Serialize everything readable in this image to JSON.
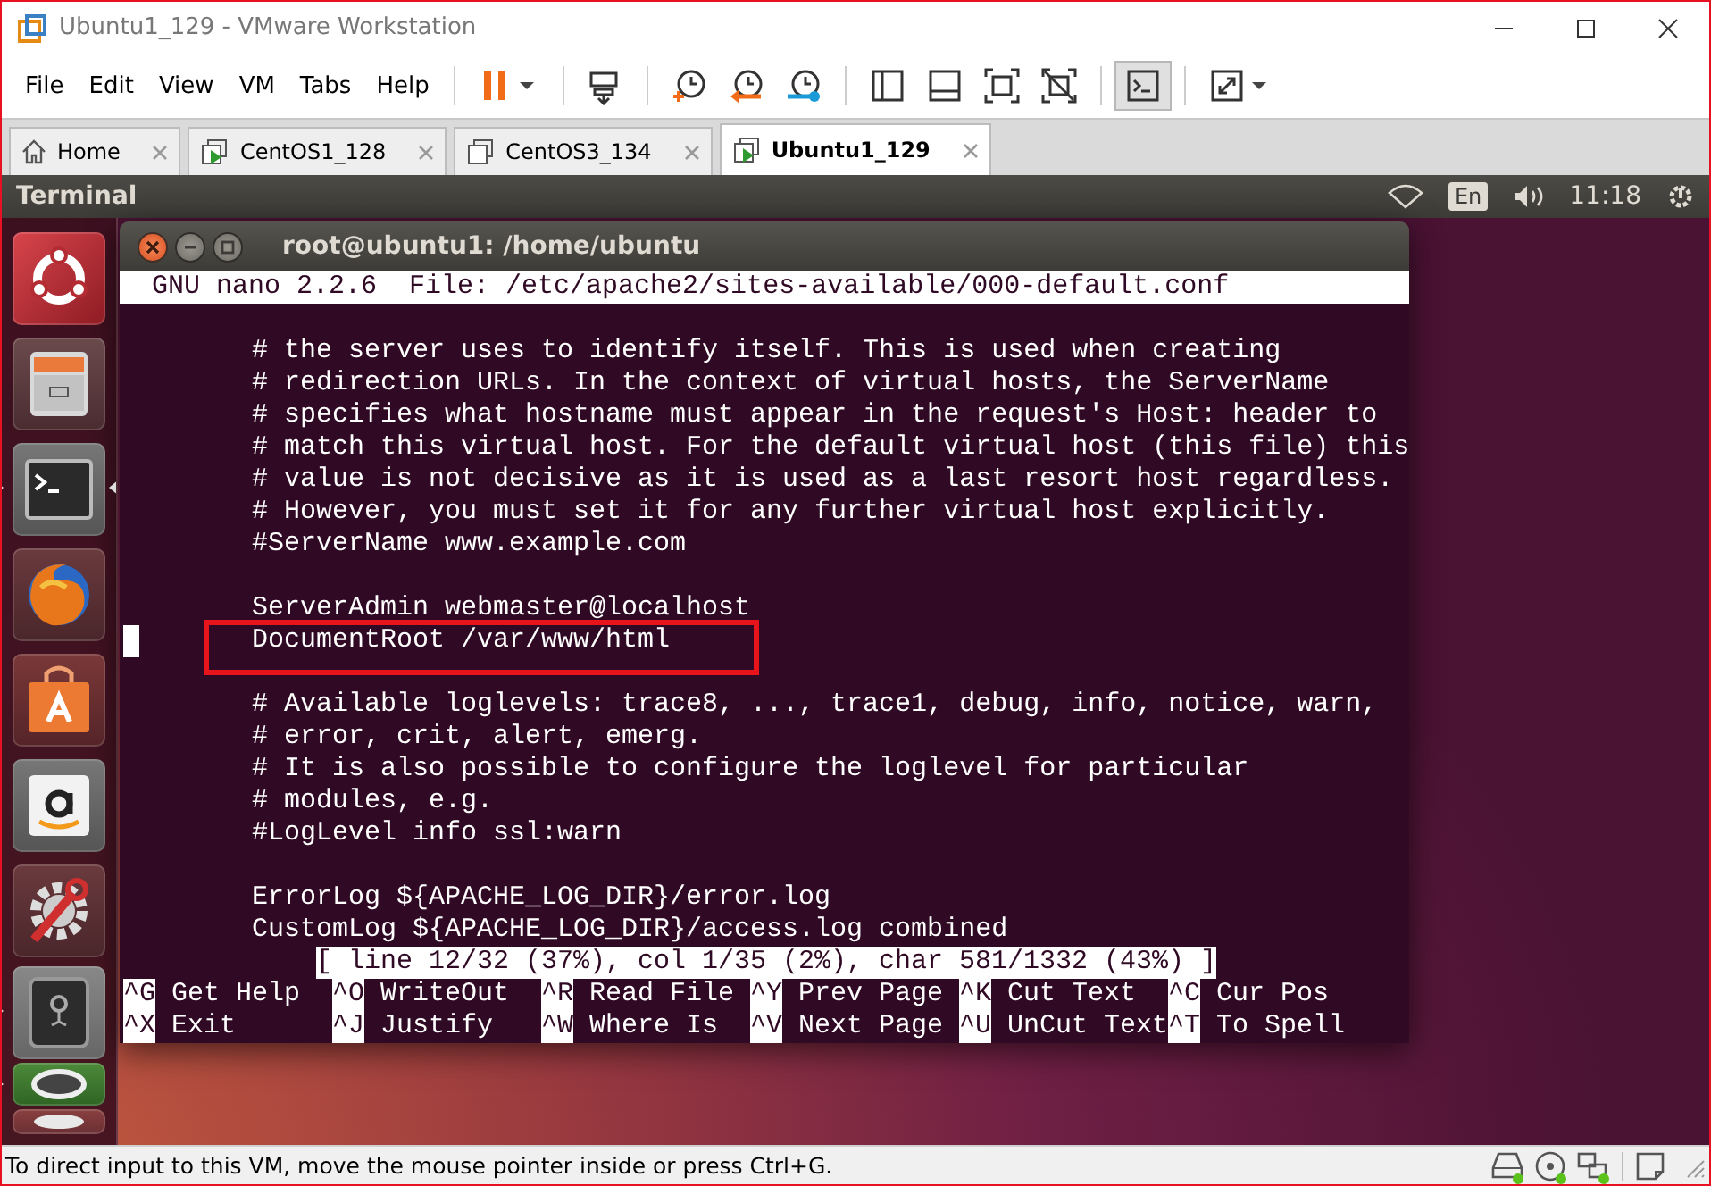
{
  "window": {
    "title": "Ubuntu1_129 - VMware Workstation"
  },
  "menu": [
    "File",
    "Edit",
    "View",
    "VM",
    "Tabs",
    "Help"
  ],
  "toolbar": [
    [
      {
        "kind": "pause",
        "selected": false
      }
    ],
    [
      {
        "kind": "send-keys",
        "selected": false
      }
    ],
    [
      {
        "kind": "snapshot-take",
        "selected": false
      },
      {
        "kind": "snapshot-revert",
        "selected": false
      },
      {
        "kind": "snapshot-manager",
        "selected": false
      }
    ],
    [
      {
        "kind": "view-sidebar",
        "selected": false
      },
      {
        "kind": "view-thumbnails",
        "selected": false
      },
      {
        "kind": "view-fullscreen",
        "selected": false
      },
      {
        "kind": "view-unity",
        "selected": false
      }
    ],
    [
      {
        "kind": "console",
        "selected": true
      }
    ],
    [
      {
        "kind": "stretch",
        "selected": false
      }
    ]
  ],
  "tabs": [
    {
      "label": "Home",
      "kind": "home",
      "selected": false
    },
    {
      "label": "CentOS1_128",
      "kind": "vm",
      "running": true,
      "selected": false
    },
    {
      "label": "CentOS3_134",
      "kind": "vm",
      "running": false,
      "selected": false
    },
    {
      "label": "Ubuntu1_129",
      "kind": "vm",
      "running": true,
      "selected": true
    }
  ],
  "guest": {
    "panel": {
      "app_name": "Terminal",
      "keyboard": "En",
      "time": "11:18"
    },
    "launcher": [
      {
        "kind": "dash",
        "running": false,
        "focused": false
      },
      {
        "kind": "files",
        "running": false,
        "focused": false
      },
      {
        "kind": "terminal",
        "running": true,
        "focused": true
      },
      {
        "kind": "firefox",
        "running": false,
        "focused": false
      },
      {
        "kind": "software-center",
        "running": false,
        "focused": false
      },
      {
        "kind": "amazon",
        "running": false,
        "focused": false
      },
      {
        "kind": "settings",
        "running": false,
        "focused": false
      },
      {
        "kind": "disk",
        "running": true,
        "focused": false
      },
      {
        "kind": "installer",
        "running": true,
        "focused": false
      },
      {
        "kind": "dvd",
        "running": false,
        "focused": false
      }
    ],
    "terminal": {
      "title": "root@ubuntu1: /home/ubuntu",
      "header": {
        "program": "GNU nano 2.2.6",
        "file": "File: /etc/apache2/sites-available/000-default.conf"
      },
      "lines": [
        {
          "kind": "blank",
          "cursor": false
        },
        {
          "kind": "text",
          "text": "# the server uses to identify itself. This is used when creating",
          "cursor": false,
          "highlighted": false
        },
        {
          "kind": "text",
          "text": "# redirection URLs. In the context of virtual hosts, the ServerName",
          "cursor": false,
          "highlighted": false
        },
        {
          "kind": "text",
          "text": "# specifies what hostname must appear in the request's Host: header to",
          "cursor": false,
          "highlighted": false
        },
        {
          "kind": "text",
          "text": "# match this virtual host. For the default virtual host (this file) this",
          "cursor": false,
          "highlighted": false
        },
        {
          "kind": "text",
          "text": "# value is not decisive as it is used as a last resort host regardless.",
          "cursor": false,
          "highlighted": false
        },
        {
          "kind": "text",
          "text": "# However, you must set it for any further virtual host explicitly.",
          "cursor": false,
          "highlighted": false
        },
        {
          "kind": "text",
          "text": "#ServerName www.example.com",
          "cursor": false,
          "highlighted": false
        },
        {
          "kind": "blank",
          "cursor": false
        },
        {
          "kind": "text",
          "text": "ServerAdmin webmaster@localhost",
          "cursor": false,
          "highlighted": false
        },
        {
          "kind": "text",
          "text": "DocumentRoot /var/www/html",
          "cursor": true,
          "highlighted": true
        },
        {
          "kind": "blank",
          "cursor": false
        },
        {
          "kind": "text",
          "text": "# Available loglevels: trace8, ..., trace1, debug, info, notice, warn,",
          "cursor": false,
          "highlighted": false
        },
        {
          "kind": "text",
          "text": "# error, crit, alert, emerg.",
          "cursor": false,
          "highlighted": false
        },
        {
          "kind": "text",
          "text": "# It is also possible to configure the loglevel for particular",
          "cursor": false,
          "highlighted": false
        },
        {
          "kind": "text",
          "text": "# modules, e.g.",
          "cursor": false,
          "highlighted": false
        },
        {
          "kind": "text",
          "text": "#LogLevel info ssl:warn",
          "cursor": false,
          "highlighted": false
        },
        {
          "kind": "blank",
          "cursor": false
        },
        {
          "kind": "text",
          "text": "ErrorLog ${APACHE_LOG_DIR}/error.log",
          "cursor": false,
          "highlighted": false
        },
        {
          "kind": "text",
          "text": "CustomLog ${APACHE_LOG_DIR}/access.log combined",
          "cursor": false,
          "highlighted": false
        }
      ],
      "status": "[ line 12/32 (37%), col 1/35 (2%), char 581/1332 (43%) ]",
      "shortcut_rows": [
        [
          {
            "key": "^G",
            "label": "Get Help"
          },
          {
            "key": "^O",
            "label": "WriteOut"
          },
          {
            "key": "^R",
            "label": "Read File"
          },
          {
            "key": "^Y",
            "label": "Prev Page"
          },
          {
            "key": "^K",
            "label": "Cut Text"
          },
          {
            "key": "^C",
            "label": "Cur Pos"
          }
        ],
        [
          {
            "key": "^X",
            "label": "Exit"
          },
          {
            "key": "^J",
            "label": "Justify"
          },
          {
            "key": "^W",
            "label": "Where Is"
          },
          {
            "key": "^V",
            "label": "Next Page"
          },
          {
            "key": "^U",
            "label": "UnCut Text"
          },
          {
            "key": "^T",
            "label": "To Spell"
          }
        ]
      ]
    }
  },
  "status_bar": {
    "message": "To direct input to this VM, move the mouse pointer inside or press Ctrl+G.",
    "devices": [
      {
        "kind": "hard-disk",
        "connected": true
      },
      {
        "kind": "cd",
        "connected": true
      },
      {
        "kind": "network",
        "connected": true
      }
    ]
  }
}
